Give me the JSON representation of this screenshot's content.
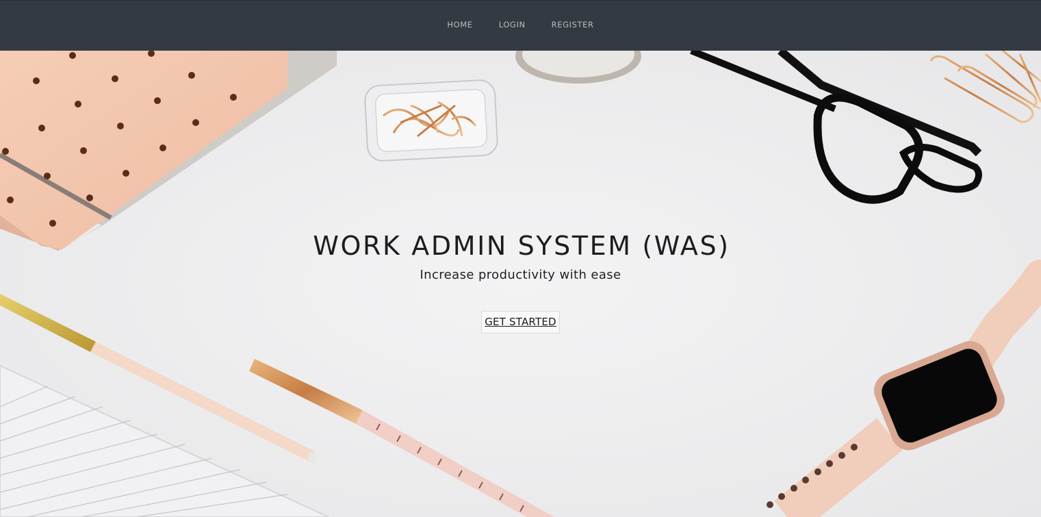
{
  "nav": {
    "items": [
      {
        "label": "HOME"
      },
      {
        "label": "LOGIN"
      },
      {
        "label": "REGISTER"
      }
    ]
  },
  "hero": {
    "title": "WORK ADMIN SYSTEM (WAS)",
    "subtitle": "Increase productivity with ease",
    "cta_label": "GET STARTED"
  },
  "colors": {
    "navbar_bg": "#343a41",
    "nav_text": "#b9bdc2",
    "hero_bg": "#eeeeef",
    "title_text": "#1d1d1f"
  }
}
